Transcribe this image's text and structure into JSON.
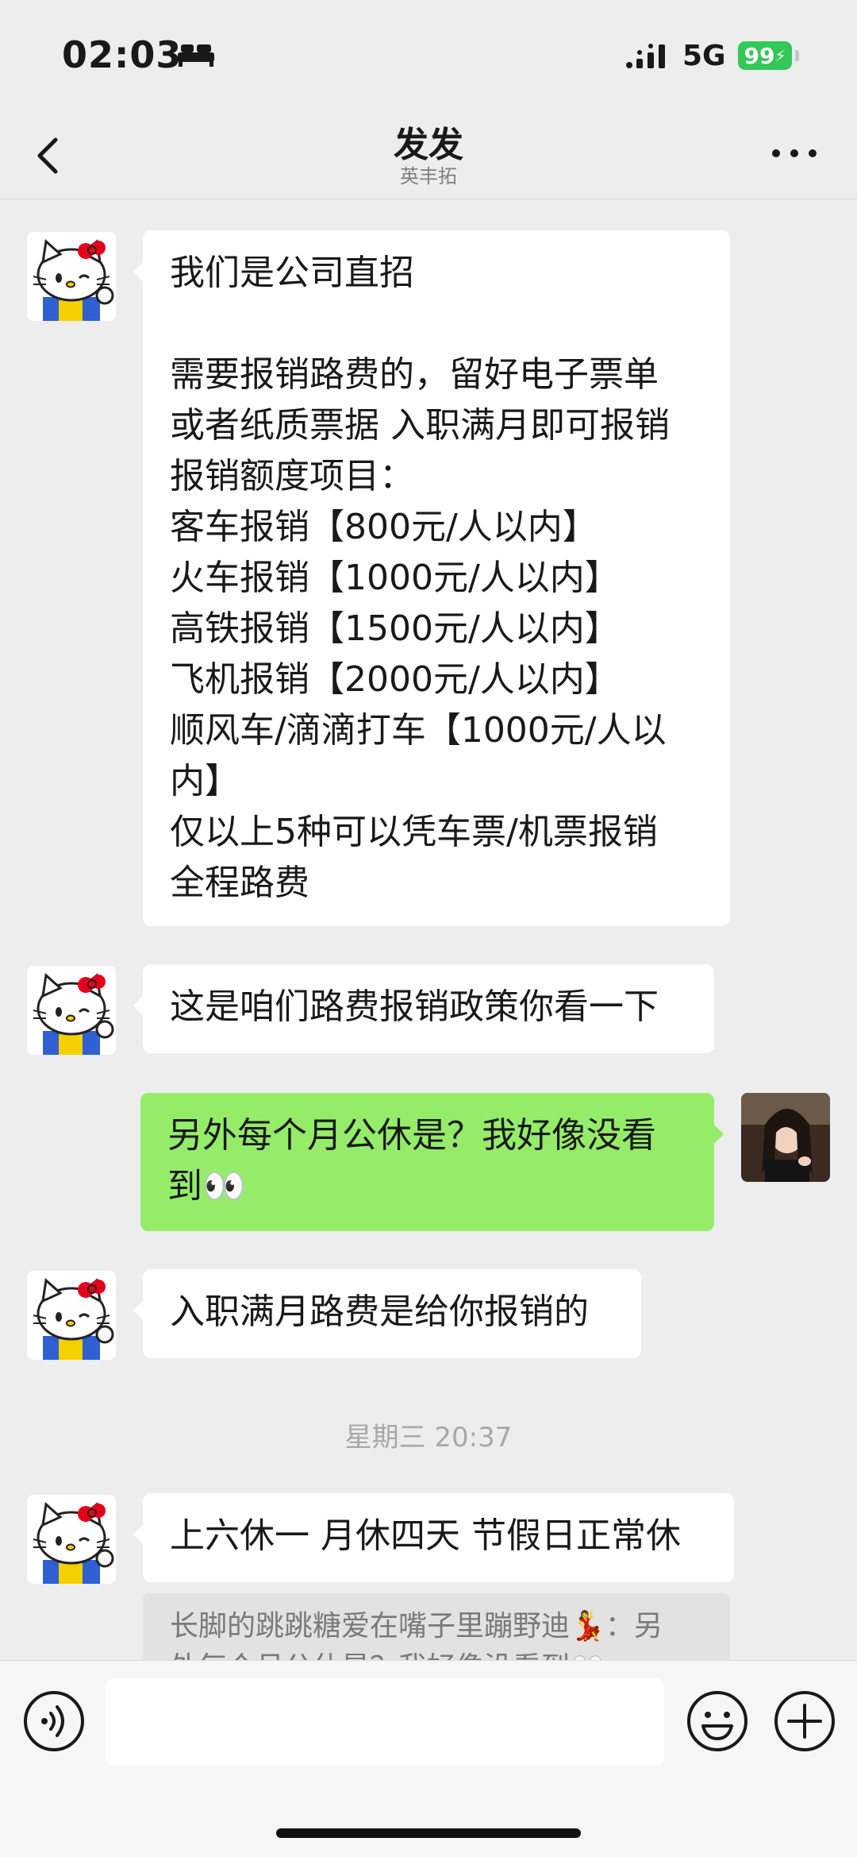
{
  "status_bar": {
    "time": "02:03",
    "network": "5G",
    "battery": "99"
  },
  "nav": {
    "title": "发发",
    "subtitle": "英丰拓",
    "back_icon": "chevron-left-icon",
    "more_icon": "more-dots-icon"
  },
  "messages": [
    {
      "side": "in",
      "lines": [
        "我们是公司直招",
        "",
        "需要报销路费的，留好电子票单",
        "或者纸质票据 入职满月即可报销",
        "报销额度项目：",
        "客车报销【800元/人以内】",
        "火车报销【1000元/人以内】",
        "高铁报销【1500元/人以内】",
        "飞机报销【2000元/人以内】",
        "顺风车/滴滴打车【1000元/人以",
        "内】",
        "仅以上5种可以凭车票/机票报销",
        "全程路费"
      ]
    },
    {
      "side": "in",
      "text": "这是咱们路费报销政策你看一下"
    },
    {
      "side": "out",
      "lines": [
        "另外每个月公休是？我好像没看",
        "到👀"
      ]
    },
    {
      "side": "in",
      "text": "入职满月路费是给你报销的"
    },
    {
      "side": "in",
      "text": "上六休一 月休四天 节假日正常休"
    }
  ],
  "timestamp": "星期三 20:37",
  "quote": {
    "line1": "长脚的跳跳糖爱在嘴子里蹦野迪💃：另",
    "line2": "外每个月公休是？我好像没看到👀"
  },
  "input": {
    "value": "",
    "placeholder": ""
  },
  "colors": {
    "background": "#ededed",
    "outgoing_bubble": "#95ec69",
    "incoming_bubble": "#ffffff",
    "battery": "#34c759"
  }
}
